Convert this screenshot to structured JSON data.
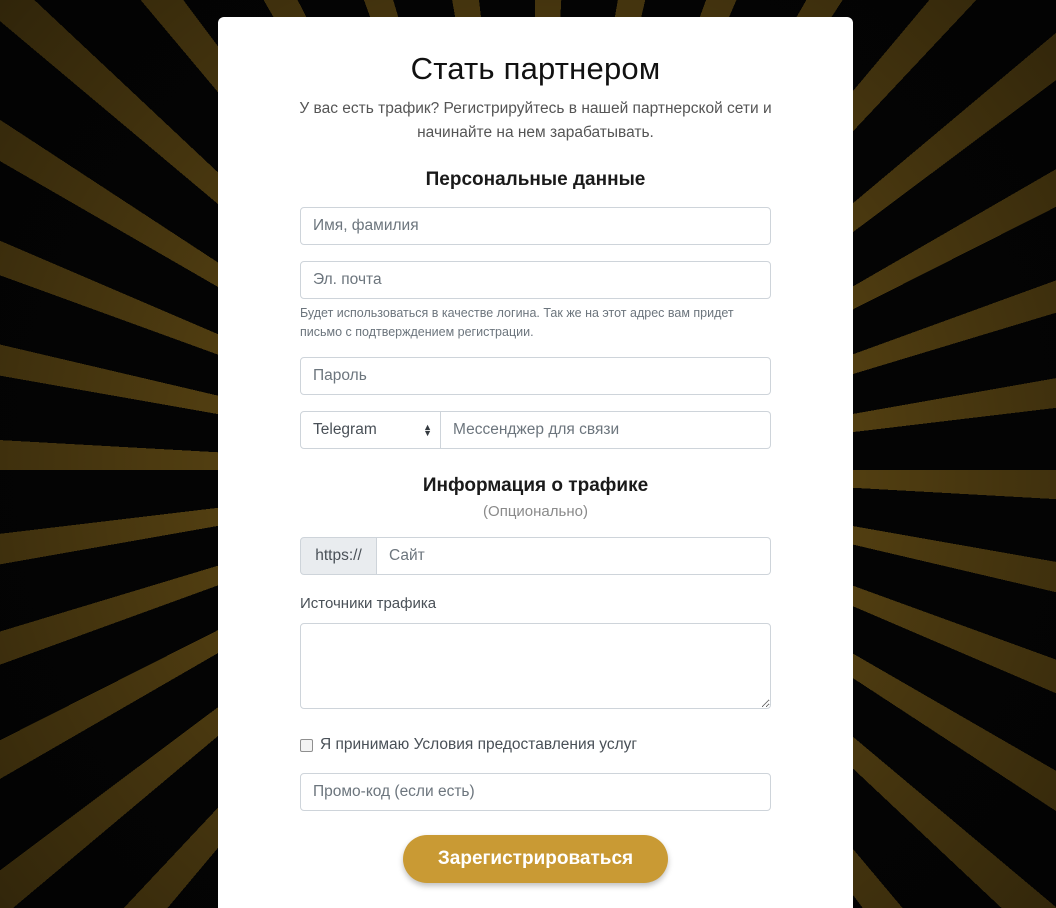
{
  "colors": {
    "accent": "#c99a34",
    "background_ray": "#6e5417",
    "background_dark": "#060606",
    "card": "#ffffff"
  },
  "header": {
    "title": "Стать партнером",
    "subtitle": "У вас есть трафик? Регистрируйтесь в нашей партнерской сети и начинайте на нем зарабатывать."
  },
  "personal": {
    "title": "Персональные данные",
    "name_placeholder": "Имя, фамилия",
    "email_placeholder": "Эл. почта",
    "email_help": "Будет использоваться в качестве логина. Так же на этот адрес вам придет письмо с подтверждением регистрации.",
    "password_placeholder": "Пароль",
    "messenger_selected": "Telegram",
    "messenger_placeholder": "Мессенджер для связи"
  },
  "traffic": {
    "title": "Информация о трафике",
    "subtitle": "(Опционально)",
    "site_prefix": "https://",
    "site_placeholder": "Сайт",
    "sources_label": "Источники трафика",
    "sources_value": ""
  },
  "terms": {
    "checked": false,
    "label": "Я принимаю Условия предоставления услуг"
  },
  "promo": {
    "placeholder": "Промо-код (если есть)"
  },
  "submit": {
    "label": "Зарегистрироваться"
  }
}
